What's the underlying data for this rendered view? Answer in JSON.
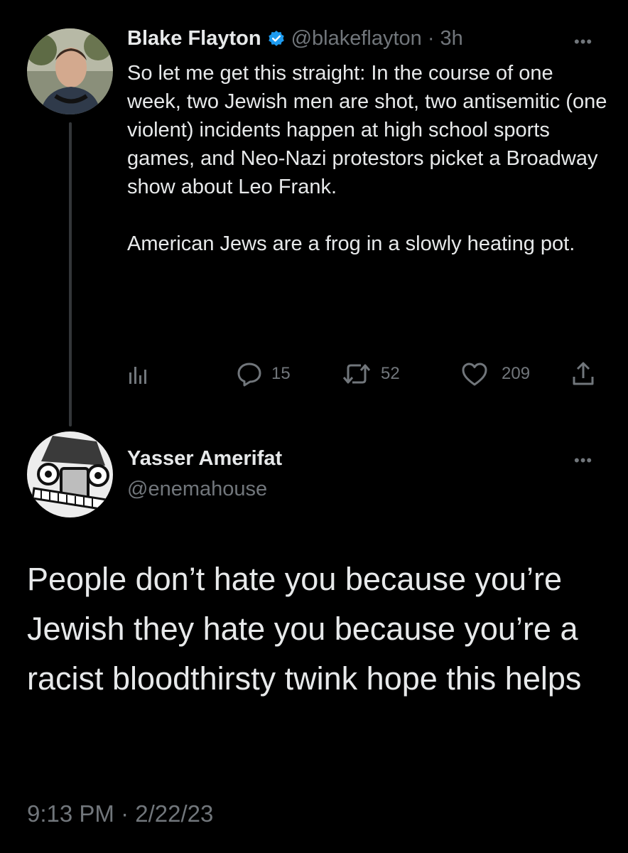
{
  "original_tweet": {
    "author_name": "Blake Flayton",
    "handle_time": "@blakeflayton · 3h",
    "more_label": "•••",
    "paragraphs": [
      "So let me get this straight: In the course of one week, two Jewish men are shot, two antisemitic (one violent) incidents happen at high school sports games, and Neo-Nazi protestors picket a Broadway show about Leo Frank.",
      "American Jews are a frog in a slowly heating pot."
    ],
    "replies_count": "15",
    "retweets_count": "52",
    "likes_count": "209",
    "icons": [
      "analytics-icon",
      "reply-icon",
      "retweet-icon",
      "like-icon",
      "share-icon"
    ],
    "verified_color": "#1d9bf0"
  },
  "reply_tweet": {
    "author_name": "Yasser Amerifat",
    "handle": "@enemahouse",
    "more_label": "•••",
    "text": "People don’t hate you because you’re Jewish they hate you because you’re a racist bloodthirsty twink hope this helps",
    "timestamp": "9:13 PM · 2/22/23"
  },
  "colors": {
    "background": "#000000",
    "text": "#e7e9ea",
    "secondary": "#71767b"
  }
}
